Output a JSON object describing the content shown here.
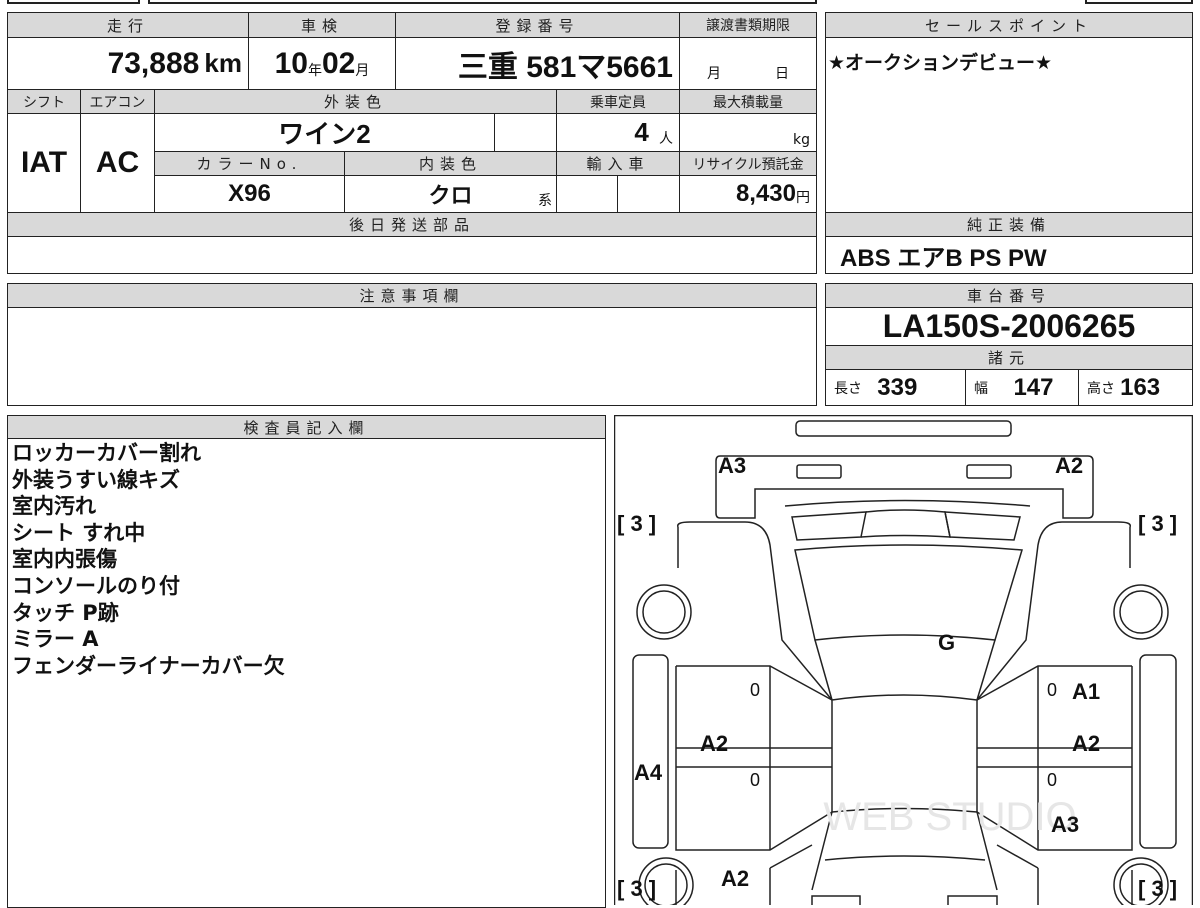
{
  "top_table": {
    "headers": {
      "mileage": "走行",
      "inspection": "車検",
      "registration": "登録番号",
      "transfer_deadline": "譲渡書類期限",
      "shift": "シフト",
      "aircon": "エアコン",
      "exterior_color": "外装色",
      "capacity": "乗車定員",
      "max_load": "最大積載量",
      "color_no": "カラーNo.",
      "interior_color": "内装色",
      "import": "輸入車",
      "recycle_fee": "リサイクル預託金",
      "later_parts": "後日発送部品"
    },
    "mileage": "73,888",
    "mileage_unit": "km",
    "inspection_year": "10",
    "year_unit": "年",
    "inspection_month": "02",
    "month_unit": "月",
    "registration": "三重 581マ5661",
    "deadline_month": "月",
    "deadline_day": "日",
    "shift": "IAT",
    "aircon": "AC",
    "exterior_color": "ワイン2",
    "capacity": "4",
    "capacity_unit": "人",
    "max_load_unit": "kg",
    "color_no": "X96",
    "interior_color": "クロ",
    "interior_suffix": "系",
    "recycle_fee": "8,430",
    "recycle_unit": "円"
  },
  "sales_point": {
    "header": "セールスポイント",
    "text": "★オークションデビュー★"
  },
  "equipment": {
    "header": "純正装備",
    "text": "ABS エアB PS PW"
  },
  "caution": {
    "header": "注意事項欄"
  },
  "chassis": {
    "header": "車台番号",
    "value": "LA150S-2006265",
    "specs_header": "諸元",
    "length_label": "長さ",
    "length": "339",
    "width_label": "幅",
    "width": "147",
    "height_label": "高さ",
    "height": "163"
  },
  "inspector": {
    "header": "検査員記入欄",
    "notes": [
      "ロッカーカバー割れ",
      "外装うすい線キズ",
      "室内汚れ",
      "シート すれ中",
      "室内内張傷",
      "コンソールのり付",
      "タッチ P跡",
      "ミラー A",
      "フェンダーライナーカバー欠"
    ]
  },
  "diagram": {
    "marks": {
      "front_left": "A3",
      "front_right": "A2",
      "tire_fl": "[ 3 ]",
      "tire_fr": "[ 3 ]",
      "tire_rl": "[ 3 ]",
      "tire_rr": "[ 3 ]",
      "windshield": "G",
      "door_fr": "A1",
      "door_rl": "A2",
      "door_rr": "A2",
      "rocker_l": "A4",
      "rear_fender_r": "A3",
      "rear_l": "A2",
      "zero1": "0",
      "zero2": "0",
      "zero3": "0",
      "zero4": "0"
    },
    "watermark": "WEB STUDIO"
  }
}
